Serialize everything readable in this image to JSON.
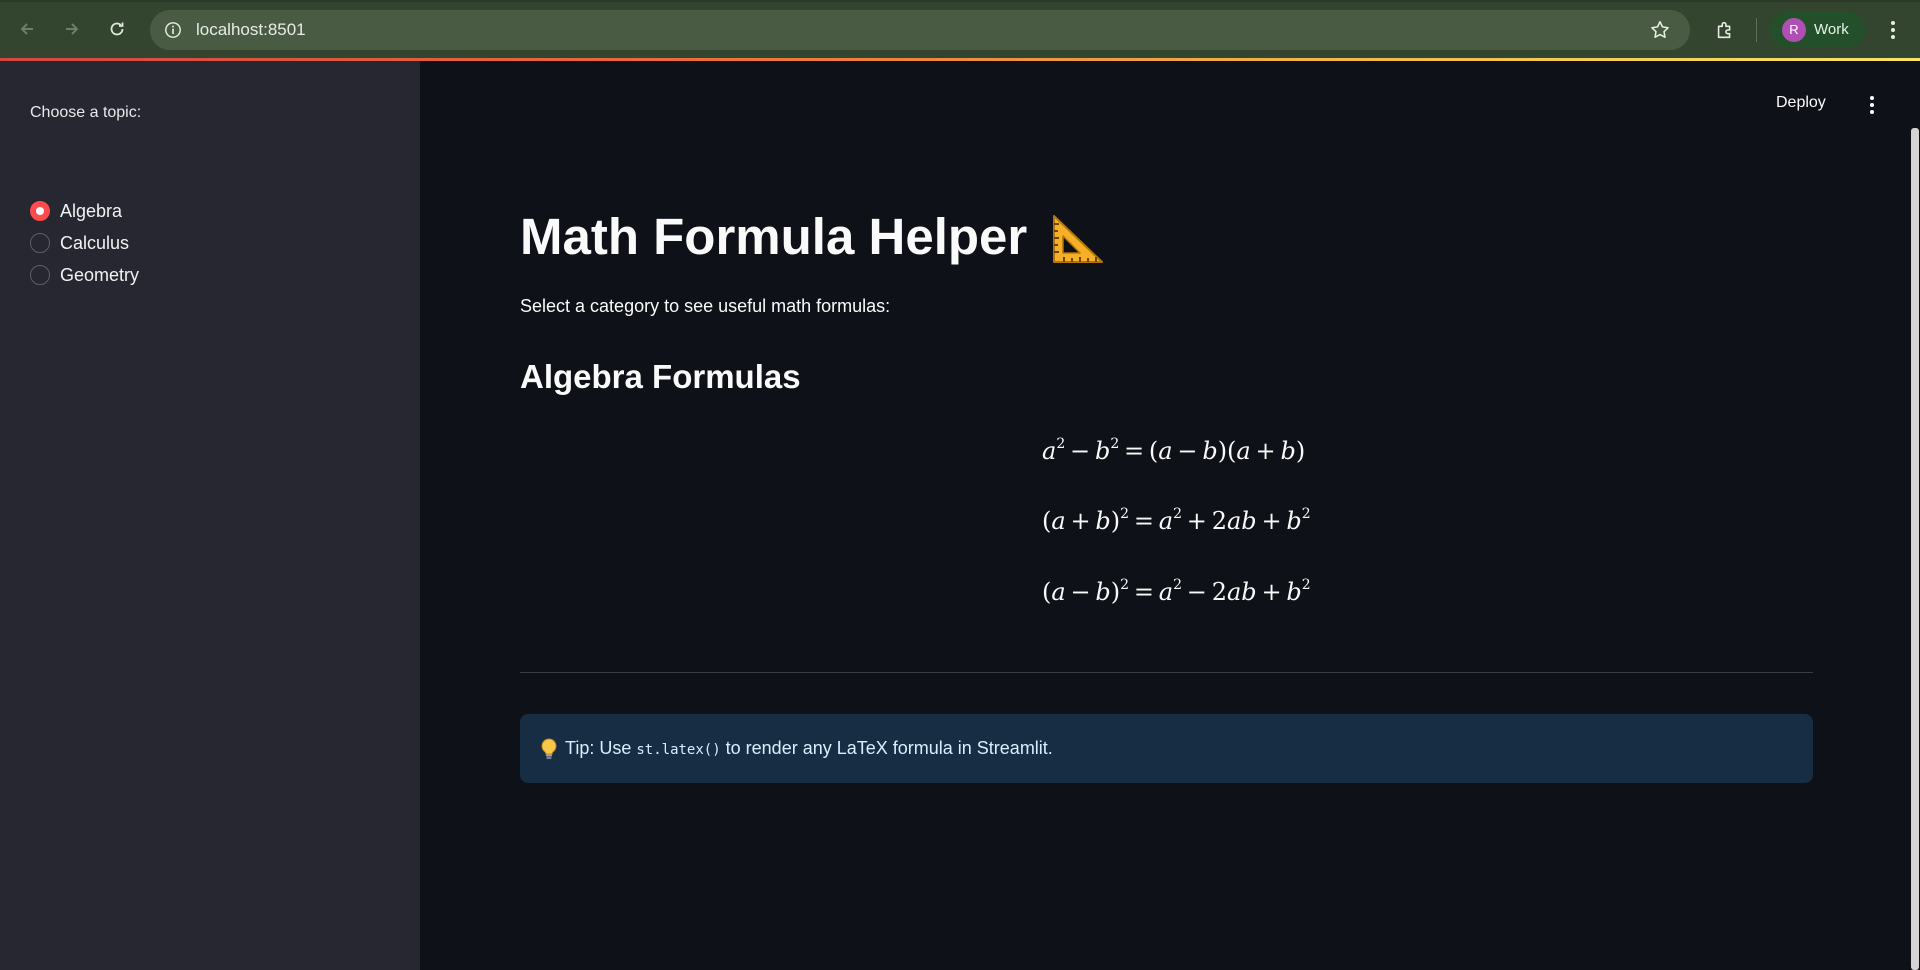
{
  "browser": {
    "url": "localhost:8501",
    "profile_initial": "R",
    "profile_name": "Work"
  },
  "sidebar": {
    "radio_label": "Choose a topic:",
    "options": [
      {
        "label": "Algebra",
        "selected": true
      },
      {
        "label": "Calculus",
        "selected": false
      },
      {
        "label": "Geometry",
        "selected": false
      }
    ]
  },
  "header": {
    "deploy_label": "Deploy"
  },
  "main": {
    "title": "Math Formula Helper",
    "title_icon": "triangular-ruler-icon",
    "subtitle": "Select a category to see useful math formulas:",
    "section_heading": "Algebra Formulas",
    "formulas": [
      "a^2 - b^2 = (a - b)(a + b)",
      "(a + b)^2 = a^2 + 2ab + b^2",
      "(a - b)^2 = a^2 - 2ab + b^2"
    ],
    "tip": {
      "icon": "light-bulb-icon",
      "prefix": "Tip: Use",
      "code": "st.latex()",
      "suffix": "to render any LaTeX formula in Streamlit."
    }
  },
  "colors": {
    "accent": "#ff4b4b",
    "sidebar_bg": "#262730",
    "main_bg": "#0e1117",
    "tip_bg": "#172d43",
    "chrome_bg": "#34452f"
  }
}
